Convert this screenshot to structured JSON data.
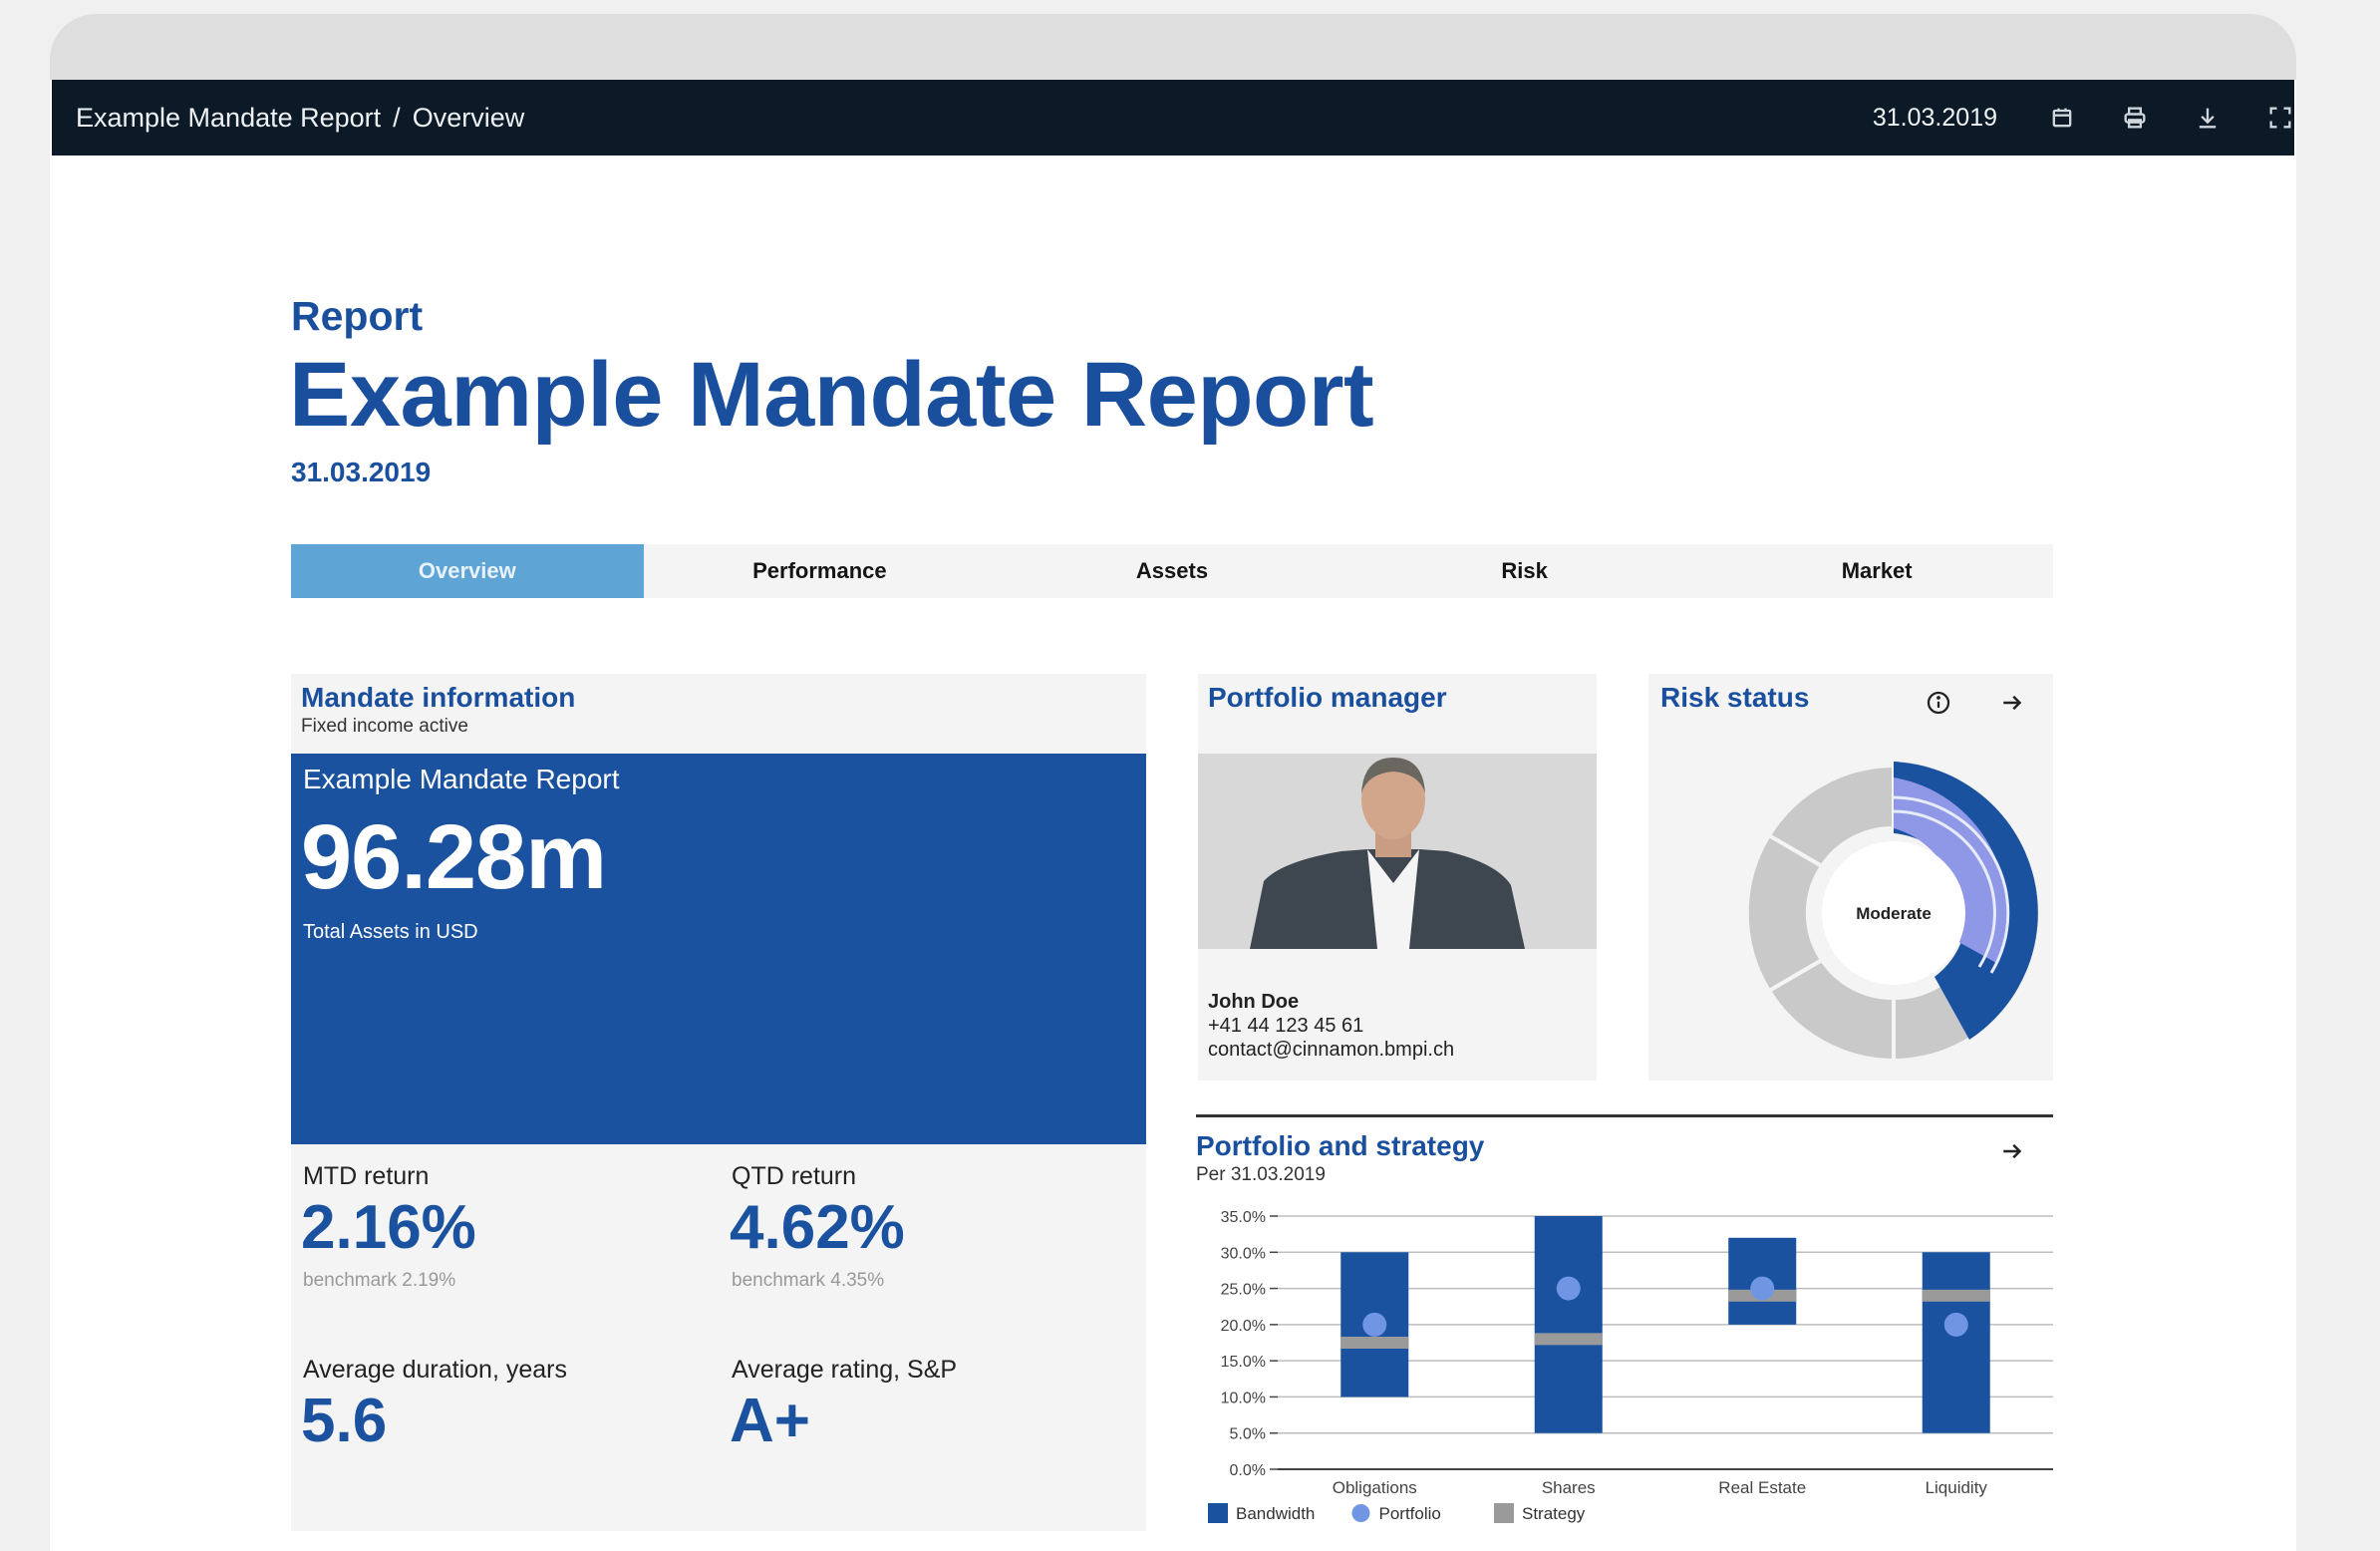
{
  "topbar": {
    "breadcrumb": [
      "Example Mandate Report",
      "Overview"
    ],
    "separator": "/",
    "date": "31.03.2019",
    "icons": [
      "calendar-icon",
      "print-icon",
      "download-icon",
      "fullscreen-icon"
    ]
  },
  "header": {
    "pre_title": "Report",
    "title": "Example Mandate Report",
    "date": "31.03.2019"
  },
  "tabs": [
    {
      "label": "Overview",
      "active": true
    },
    {
      "label": "Performance",
      "active": false
    },
    {
      "label": "Assets",
      "active": false
    },
    {
      "label": "Risk",
      "active": false
    },
    {
      "label": "Market",
      "active": false
    }
  ],
  "mandate": {
    "title": "Mandate information",
    "subtitle": "Fixed income active",
    "name": "Example Mandate Report",
    "total_assets": "96.28m",
    "total_assets_label": "Total Assets in USD",
    "kpis": [
      {
        "label": "MTD return",
        "value": "2.16%",
        "benchmark": "benchmark 2.19%"
      },
      {
        "label": "QTD return",
        "value": "4.62%",
        "benchmark": "benchmark 4.35%"
      },
      {
        "label": "Average duration, years",
        "value": "5.6",
        "benchmark": ""
      },
      {
        "label": "Average rating, S&P",
        "value": "A+",
        "benchmark": ""
      }
    ]
  },
  "portfolio_manager": {
    "title": "Portfolio manager",
    "name": "John Doe",
    "phone": "+41 44 123 45 61",
    "email": "contact@cinnamon.bmpi.ch"
  },
  "risk_status": {
    "title": "Risk status",
    "label": "Moderate",
    "icons": [
      "info-icon",
      "arrow-right-icon"
    ]
  },
  "strategy": {
    "title": "Portfolio and strategy",
    "subtitle": "Per 31.03.2019",
    "icon": "arrow-right-icon"
  },
  "colors": {
    "brand_blue": "#1a4f9e",
    "box_blue": "#1a52a0",
    "tab_active": "#5ea5d6",
    "topbar": "#0b1a26",
    "portfolio_point": "#6f95e3",
    "strategy_line": "#9a9a9a"
  },
  "chart_data": {
    "type": "bar",
    "categories": [
      "Obligations",
      "Shares",
      "Real Estate",
      "Liquidity"
    ],
    "y_ticks": [
      "0.0%",
      "5.0%",
      "10.0%",
      "15.0%",
      "20.0%",
      "25.0%",
      "30.0%",
      "35.0%"
    ],
    "ylim": [
      0,
      35
    ],
    "grid": true,
    "legend_position": "bottom-left",
    "series": [
      {
        "name": "Bandwidth",
        "type": "range",
        "low": [
          10,
          5,
          20,
          5
        ],
        "high": [
          30,
          35,
          32,
          30
        ]
      },
      {
        "name": "Portfolio",
        "type": "point",
        "values": [
          20,
          25,
          25,
          20
        ]
      },
      {
        "name": "Strategy",
        "type": "line",
        "values": [
          17.5,
          18,
          24,
          24
        ]
      }
    ]
  }
}
